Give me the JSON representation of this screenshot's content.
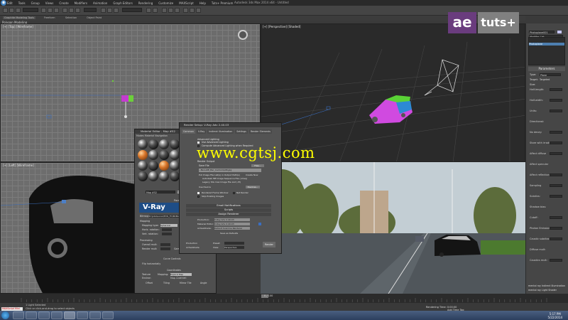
{
  "app": {
    "title": "Autodesk 3ds Max 2014 x64 - Untitled",
    "icon": "3ds-max-logo-icon",
    "menus": [
      "Edit",
      "Tools",
      "Group",
      "Views",
      "Create",
      "Modifiers",
      "Animation",
      "Graph Editors",
      "Rendering",
      "Customize",
      "MAXScript",
      "Help",
      "Tuts+ Premium"
    ],
    "ribbon_tabs": [
      "Graphite Modeling Tools",
      "Freeform",
      "Selection",
      "Object Paint"
    ],
    "ribbon_active": "Polygon Modeling"
  },
  "viewports": {
    "top": "[+] [Top] [Wireframe]",
    "perspective": "[+] [Perspective] [Shaded]",
    "left": "[+] [Left] [Wireframe]"
  },
  "logo": {
    "ae": "ae",
    "tuts": "tuts+"
  },
  "watermark": "www.cgtsj.com",
  "render_dialog": {
    "title": "Render Setup: V-Ray Adv 2.40.03",
    "tabs": [
      "Common",
      "V-Ray",
      "Indirect Illumination",
      "Settings",
      "Render Elements"
    ],
    "options": [
      {
        "label": "Advanced Lighting",
        "checked": false
      },
      {
        "label": "Use Advanced Lighting",
        "checked": true
      },
      {
        "label": "Compute Advanced Lighting when Required",
        "checked": false
      }
    ],
    "render_output": "Render Output",
    "save_file": "Save File",
    "files_button": "Files...",
    "file_path": "...BenuDE_Bar_CarComp06.jpg",
    "put_image": "Put Image File List(s) in Output Path(s)",
    "create_now": "Create Now",
    "autodesk_me": "Autodesk ME Image Sequence File (.imsq)",
    "legacy": "Legacy 3ds max Image File List (.ifl)",
    "use_device": "Use Device",
    "devices_button": "Devices...",
    "rendered_frame_window": "Rendered Frame Window",
    "net_render": "Net Render",
    "skip_existing": "Skip Existing Images",
    "sections": [
      "Email Notifications",
      "Scripts",
      "Assign Renderer"
    ],
    "production_label": "Production:",
    "production_value": "V-Ray Adv 2.40.03",
    "material_editor_label": "Material Editor:",
    "material_editor_value": "V-Ray Adv 2.40.03",
    "activeshade_label": "ActiveShade:",
    "activeshade_value": "Default Scanline Renderer",
    "save_default": "Save as Defaults",
    "preset_label": "Preset:",
    "view_label": "View:",
    "view_value": "Perspective",
    "production_mode": "Production",
    "activeshade_mode": "ActiveShade",
    "render_button": "Render"
  },
  "material_editor": {
    "title": "Material Editor - Map #52",
    "menu": [
      "Modes",
      "Material",
      "Navigation"
    ],
    "map_name": "Map #52",
    "map_type": "VRayHDRI",
    "vray_logo": "V-Ray",
    "vray_version": "V-RAY",
    "param_header": "Parameters",
    "bitmap_label": "Bitmap:",
    "bitmap_value": "D:\\Jobs\\Lunar\\EVO_FC\\BCBARBAS...",
    "mapping_header": "Mapping",
    "mapping_type_label": "Mapping type:",
    "mapping_type_value": "Spherical",
    "horiz_rotation": "Horiz. rotation:",
    "vert_rotation": "Vert. rotation:",
    "processing_header": "Processing",
    "overall_mult": "Overall mult:",
    "render_mult": "Render mult:",
    "gamma_label": "Gamma:",
    "gamma_value": "1.0",
    "gamma_btn": "Gamma",
    "curves_header": "Curve Controls",
    "flipbook": "Flip horizontally",
    "coordinates": "Coordinates",
    "texture": "Texture",
    "env": "Environ",
    "mapping": "Mapping:",
    "mapping_value": "Explicit Map Channel",
    "map_channel": "Map Channel:",
    "offset": "Offset",
    "tiling": "Tiling",
    "mirror_tile": "Mirror Tile",
    "angle": "Angle"
  },
  "command_panel": {
    "object_label": "Photoplane001",
    "modifier_list": "Modifier List",
    "stack_item": "Photoplane",
    "parameters": "Parameters",
    "type_label": "Type:",
    "type_value": "Plane",
    "target_label": "Target:",
    "targeted": "Targeted",
    "size_label": "Size:",
    "rows": [
      "Half-length:",
      "Half-width:",
      "Units:",
      "Directional:",
      "No decay:",
      "Store with irradiance map",
      "Affect diffuse",
      "Affect specular",
      "Affect reflections",
      "Sampling",
      "Subdivs:",
      "Shadow bias:",
      "Cutoff:",
      "Photon Emission",
      "Caustic subdivs:",
      "Diffuse mult:",
      "Caustics mult:"
    ],
    "footer": "mental ray Indirect Illumination",
    "footer2": "mental ray Light Shader"
  },
  "status": {
    "maxscript": "MAXScript Mini",
    "selected": "1 Light Selected",
    "prompt": "Click or click-and-drag to select objects",
    "rendering": "Rendering Time: 0:00:00",
    "add_time_tag": "Add Time Tag",
    "timeline": "0 / 100"
  },
  "taskbar": {
    "apps": [
      "start-orb-icon",
      "ie-icon",
      "folder-icon",
      "media-icon",
      "chrome-icon",
      "3dsmax-icon",
      "photoshop-icon",
      "firefox-icon",
      "vlc-icon"
    ],
    "time": "5:17 PM",
    "date": "5/22/2014"
  },
  "colors": {
    "accent": "#4d7fb0",
    "vray_blue": "#1e4d86",
    "ae_purple": "#6a3c7e",
    "watermark": "#ffff00"
  }
}
